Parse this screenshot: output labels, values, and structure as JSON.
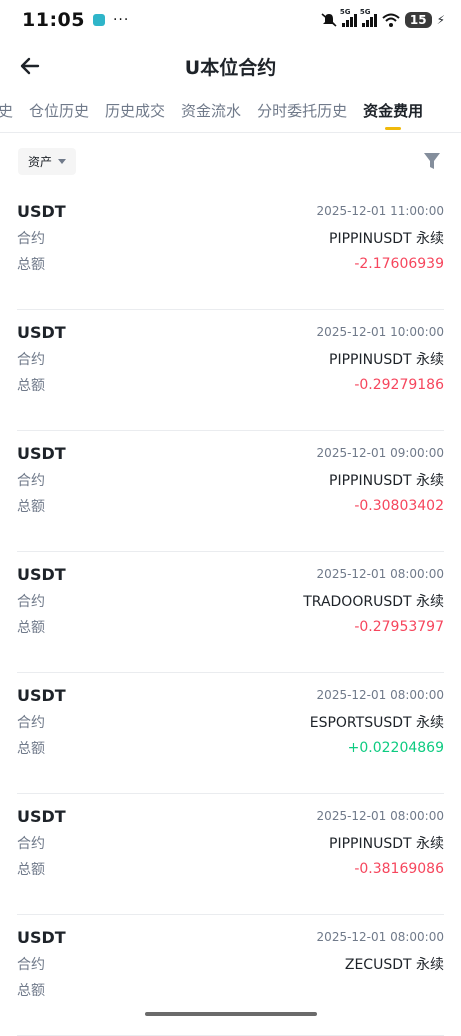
{
  "status_bar": {
    "time": "11:05",
    "dots": "···",
    "battery": "15"
  },
  "header": {
    "title": "U本位合约"
  },
  "tabs": [
    {
      "label": "史"
    },
    {
      "label": "仓位历史"
    },
    {
      "label": "历史成交"
    },
    {
      "label": "资金流水"
    },
    {
      "label": "分时委托历史"
    },
    {
      "label": "资金费用"
    }
  ],
  "filter": {
    "asset_label": "资产"
  },
  "labels": {
    "contract": "合约",
    "total": "总额"
  },
  "colors": {
    "negative": "#f6465d",
    "positive": "#0ecb81",
    "accent": "#f0b90b"
  },
  "records": [
    {
      "asset": "USDT",
      "time": "2025-12-01 11:00:00",
      "contract": "PIPPINUSDT 永续",
      "amount": "-2.17606939"
    },
    {
      "asset": "USDT",
      "time": "2025-12-01 10:00:00",
      "contract": "PIPPINUSDT 永续",
      "amount": "-0.29279186"
    },
    {
      "asset": "USDT",
      "time": "2025-12-01 09:00:00",
      "contract": "PIPPINUSDT 永续",
      "amount": "-0.30803402"
    },
    {
      "asset": "USDT",
      "time": "2025-12-01 08:00:00",
      "contract": "TRADOORUSDT 永续",
      "amount": "-0.27953797"
    },
    {
      "asset": "USDT",
      "time": "2025-12-01 08:00:00",
      "contract": "ESPORTSUSDT 永续",
      "amount": "+0.02204869"
    },
    {
      "asset": "USDT",
      "time": "2025-12-01 08:00:00",
      "contract": "PIPPINUSDT 永续",
      "amount": "-0.38169086"
    },
    {
      "asset": "USDT",
      "time": "2025-12-01 08:00:00",
      "contract": "ZECUSDT 永续",
      "amount": ""
    }
  ]
}
